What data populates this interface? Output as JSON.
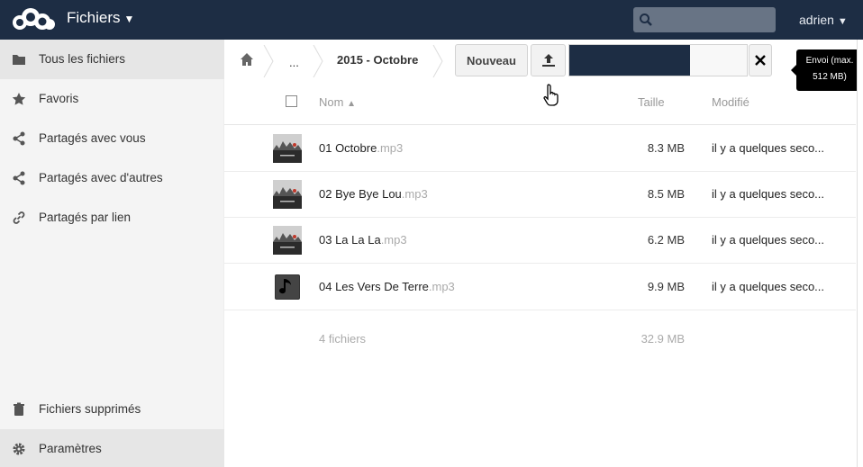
{
  "header": {
    "app_title": "Fichiers",
    "user": "adrien",
    "search_placeholder": ""
  },
  "sidebar": {
    "items": [
      {
        "label": "Tous les fichiers",
        "icon": "folder-icon",
        "active": true
      },
      {
        "label": "Favoris",
        "icon": "star-icon"
      },
      {
        "label": "Partagés avec vous",
        "icon": "share-icon"
      },
      {
        "label": "Partagés avec d'autres",
        "icon": "share-icon"
      },
      {
        "label": "Partagés par lien",
        "icon": "link-icon"
      }
    ],
    "trash_label": "Fichiers supprimés",
    "settings_label": "Paramètres"
  },
  "breadcrumb": {
    "ellipsis": "...",
    "current": "2015 - Octobre"
  },
  "toolbar": {
    "new_label": "Nouveau",
    "upload_progress": 0.68,
    "tooltip_line1": "Envoi (max.",
    "tooltip_line2": "512 MB)"
  },
  "table": {
    "headers": {
      "name": "Nom",
      "size": "Taille",
      "modified": "Modifié"
    },
    "rows": [
      {
        "name": "01 Octobre",
        "ext": ".mp3",
        "size": "8.3 MB",
        "modified": "il y a quelques seco...",
        "thumb": "album-cover"
      },
      {
        "name": "02 Bye Bye Lou",
        "ext": ".mp3",
        "size": "8.5 MB",
        "modified": "il y a quelques seco...",
        "thumb": "album-cover"
      },
      {
        "name": "03 La La La",
        "ext": ".mp3",
        "size": "6.2 MB",
        "modified": "il y a quelques seco...",
        "thumb": "album-cover"
      },
      {
        "name": "04 Les Vers De Terre",
        "ext": ".mp3",
        "size": "9.9 MB",
        "modified": "il y a quelques seco...",
        "thumb": "music-note-icon"
      }
    ],
    "summary_count": "4 fichiers",
    "summary_size": "32.9 MB"
  },
  "colors": {
    "header_bg": "#1d2d44",
    "sidebar_bg": "#f4f4f4"
  }
}
